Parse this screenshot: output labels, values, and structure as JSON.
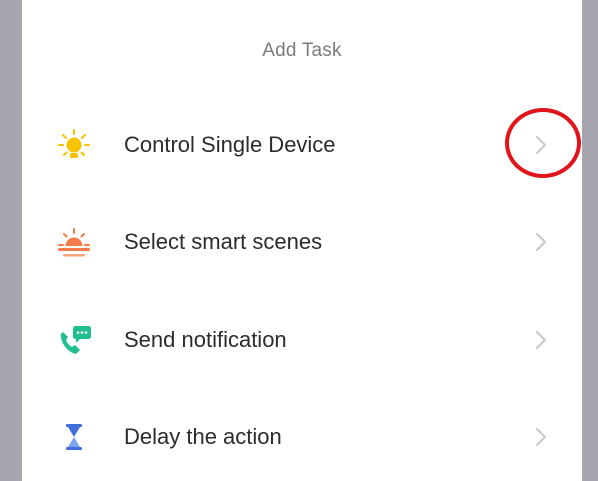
{
  "sheet": {
    "title": "Add Task"
  },
  "tasks": [
    {
      "label": "Control Single Device",
      "icon": "bulb-icon",
      "color": "#f6c400"
    },
    {
      "label": "Select smart scenes",
      "icon": "sunset-icon",
      "color": "#f47b4a"
    },
    {
      "label": "Send notification",
      "icon": "phone-message-icon",
      "color": "#1fbf8f"
    },
    {
      "label": "Delay the action",
      "icon": "hourglass-icon",
      "color": "#3f6fd8"
    }
  ],
  "colors": {
    "backdrop": "#a7a6af",
    "annotation": "#e1141b",
    "chevron": "#c7c7cc"
  }
}
